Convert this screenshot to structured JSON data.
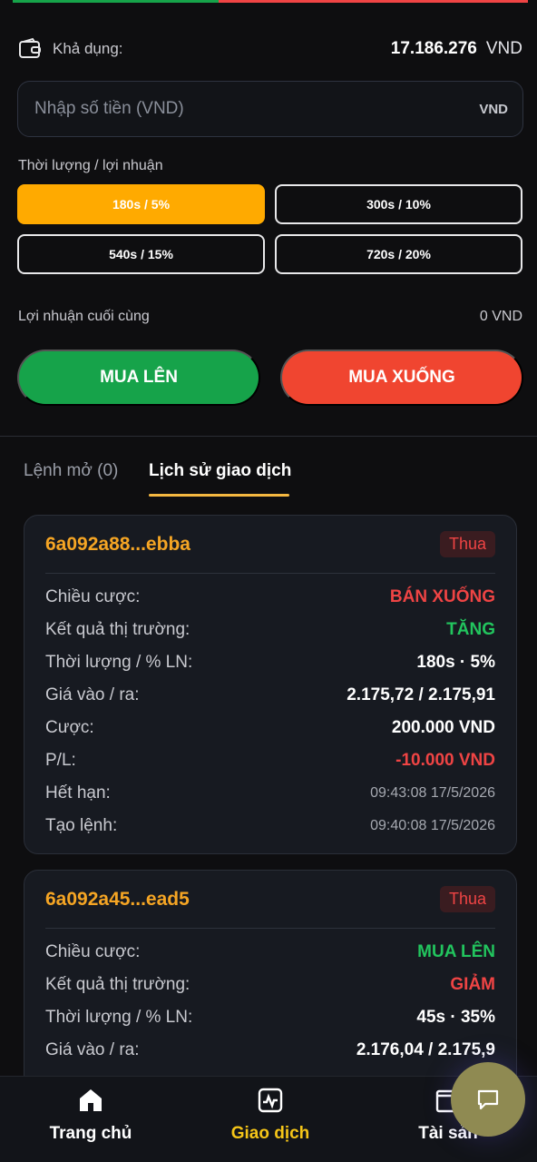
{
  "balance": {
    "label": "Khả dụng:",
    "value": "17.186.276",
    "unit": "VND"
  },
  "amount_input": {
    "placeholder": "Nhập số tiền (VND)",
    "unit": "VND"
  },
  "duration": {
    "label": "Thời lượng / lợi nhuận",
    "options": [
      "180s / 5%",
      "300s / 10%",
      "540s / 15%",
      "720s / 20%"
    ],
    "selected": "180s / 5%"
  },
  "final_profit": {
    "label": "Lợi nhuận cuối cùng",
    "value": "0 VND"
  },
  "actions": {
    "buy_up": "MUA LÊN",
    "buy_down": "MUA XUỐNG"
  },
  "tabs": {
    "open": "Lệnh mở (0)",
    "history": "Lịch sử giao dịch",
    "active": "history"
  },
  "orders": [
    {
      "id": "6a092a88...ebba",
      "status": "Thua",
      "rows": [
        {
          "label": "Chiều cược:",
          "value": "BÁN XUỐNG",
          "tone": "red"
        },
        {
          "label": "Kết quả thị trường:",
          "value": "TĂNG",
          "tone": "green"
        },
        {
          "label": "Thời lượng / % LN:",
          "value": "180s · 5%",
          "tone": "plain"
        },
        {
          "label": "Giá vào / ra:",
          "value": "2.175,72 / 2.175,91",
          "tone": "plain"
        },
        {
          "label": "Cược:",
          "value": "200.000 VND",
          "tone": "plain"
        },
        {
          "label": "P/L:",
          "value": "-10.000 VND",
          "tone": "red"
        },
        {
          "label": "Hết hạn:",
          "value": "09:43:08 17/5/2026",
          "tone": "muted"
        },
        {
          "label": "Tạo lệnh:",
          "value": "09:40:08 17/5/2026",
          "tone": "muted"
        }
      ]
    },
    {
      "id": "6a092a45...ead5",
      "status": "Thua",
      "rows": [
        {
          "label": "Chiều cược:",
          "value": "MUA LÊN",
          "tone": "green"
        },
        {
          "label": "Kết quả thị trường:",
          "value": "GIẢM",
          "tone": "red"
        },
        {
          "label": "Thời lượng / % LN:",
          "value": "45s · 35%",
          "tone": "plain"
        },
        {
          "label": "Giá vào / ra:",
          "value": "2.176,04 / 2.175,9",
          "tone": "plain"
        }
      ]
    }
  ],
  "nav": {
    "items": [
      {
        "label": "Trang chủ",
        "icon": "home-icon"
      },
      {
        "label": "Giao dịch",
        "icon": "chart-icon",
        "active": true
      },
      {
        "label": "Tài sản",
        "icon": "wallet-icon"
      }
    ]
  },
  "colors": {
    "accent": "#ffaa00",
    "up": "#16a34a",
    "down": "#f04530",
    "order_id": "#f5a524",
    "nav_active": "#f5c518",
    "fab": "#8f8a52"
  },
  "chat_fab": {
    "icon": "chat-bubble-icon"
  }
}
